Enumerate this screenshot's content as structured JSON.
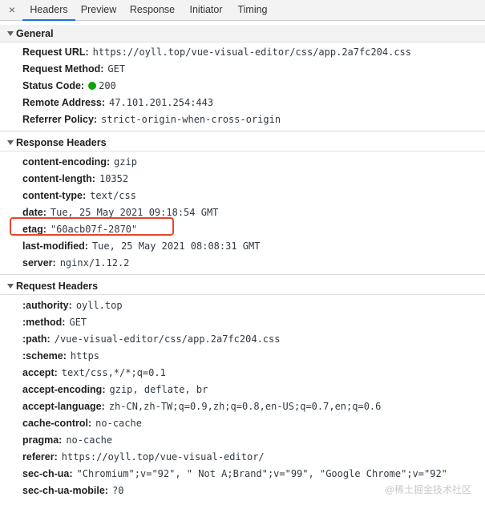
{
  "tabs": {
    "close_icon": "×",
    "items": [
      "Headers",
      "Preview",
      "Response",
      "Initiator",
      "Timing"
    ],
    "active": "Headers"
  },
  "general": {
    "title": "General",
    "request_url": {
      "key": "Request URL:",
      "value": "https://oyll.top/vue-visual-editor/css/app.2a7fc204.css"
    },
    "request_method": {
      "key": "Request Method:",
      "value": "GET"
    },
    "status_code": {
      "key": "Status Code:",
      "value": "200",
      "color": "#0ca40c"
    },
    "remote_address": {
      "key": "Remote Address:",
      "value": "47.101.201.254:443"
    },
    "referrer_policy": {
      "key": "Referrer Policy:",
      "value": "strict-origin-when-cross-origin"
    }
  },
  "response_headers": {
    "title": "Response Headers",
    "rows": [
      {
        "key": "content-encoding:",
        "value": "gzip"
      },
      {
        "key": "content-length:",
        "value": "10352"
      },
      {
        "key": "content-type:",
        "value": "text/css"
      },
      {
        "key": "date:",
        "value": "Tue, 25 May 2021 09:18:54 GMT"
      },
      {
        "key": "etag:",
        "value": "\"60acb07f-2870\""
      },
      {
        "key": "last-modified:",
        "value": "Tue, 25 May 2021 08:08:31 GMT"
      },
      {
        "key": "server:",
        "value": "nginx/1.12.2"
      }
    ],
    "highlight_color": "#e8452c"
  },
  "request_headers": {
    "title": "Request Headers",
    "rows": [
      {
        "key": ":authority:",
        "value": "oyll.top"
      },
      {
        "key": ":method:",
        "value": "GET"
      },
      {
        "key": ":path:",
        "value": "/vue-visual-editor/css/app.2a7fc204.css"
      },
      {
        "key": ":scheme:",
        "value": "https"
      },
      {
        "key": "accept:",
        "value": "text/css,*/*;q=0.1"
      },
      {
        "key": "accept-encoding:",
        "value": "gzip, deflate, br"
      },
      {
        "key": "accept-language:",
        "value": "zh-CN,zh-TW;q=0.9,zh;q=0.8,en-US;q=0.7,en;q=0.6"
      },
      {
        "key": "cache-control:",
        "value": "no-cache"
      },
      {
        "key": "pragma:",
        "value": "no-cache"
      },
      {
        "key": "referer:",
        "value": "https://oyll.top/vue-visual-editor/"
      },
      {
        "key": "sec-ch-ua:",
        "value": "\"Chromium\";v=\"92\", \" Not A;Brand\";v=\"99\", \"Google Chrome\";v=\"92\""
      },
      {
        "key": "sec-ch-ua-mobile:",
        "value": "?0"
      }
    ]
  },
  "watermark": "@稀土掘金技术社区"
}
